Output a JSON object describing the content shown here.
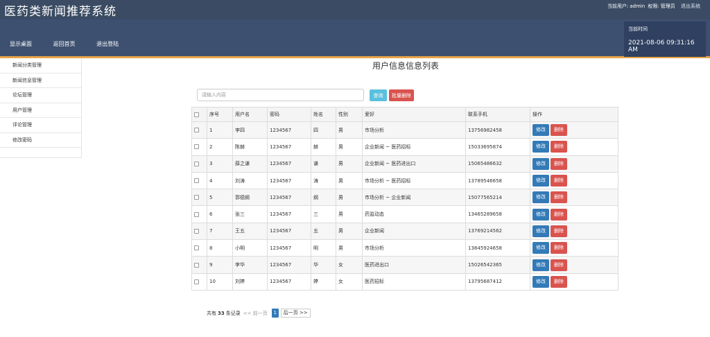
{
  "app": {
    "title": "医药类新闻推荐系统"
  },
  "header": {
    "user_label": "当前用户:",
    "user_name": "admin",
    "role_label": "权限:",
    "role_name": "管理员",
    "logout_label": "退出系统"
  },
  "nav": {
    "items": [
      "显示桌面",
      "返回首页",
      "退出登陆"
    ]
  },
  "clock": {
    "label": "当前时间",
    "value": "2021-08-06 09:31:16 AM"
  },
  "sidebar": {
    "items": [
      "新闻分类管理",
      "新闻信息管理",
      "论坛管理",
      "用户管理",
      "评论管理",
      "修改密码"
    ]
  },
  "main": {
    "title": "用户信息信息列表",
    "search_placeholder": "请输入内容",
    "search_button": "查询",
    "batch_delete_button": "批量删除"
  },
  "table": {
    "columns": [
      "序号",
      "用户名",
      "密码",
      "姓名",
      "性别",
      "爱好",
      "联系手机",
      "操作"
    ],
    "edit_label": "修改",
    "delete_label": "删除",
    "rows": [
      [
        "1",
        "李四",
        "1234567",
        "四",
        "男",
        "市场分析",
        "13756982458"
      ],
      [
        "2",
        "陈赫",
        "1234567",
        "赫",
        "男",
        "企业新闻 ~ 医药招标",
        "15033695874"
      ],
      [
        "3",
        "薛之谦",
        "1234567",
        "谦",
        "男",
        "企业新闻 ~ 医药进出口",
        "15065486632"
      ],
      [
        "4",
        "刘涛",
        "1234567",
        "涛",
        "男",
        "市场分析 ~ 医药招标",
        "13789546658"
      ],
      [
        "5",
        "郭德纲",
        "1234567",
        "纲",
        "男",
        "市场分析 ~ 企业新闻",
        "15077565214"
      ],
      [
        "6",
        "张三",
        "1234567",
        "三",
        "男",
        "药监动态",
        "13465289658"
      ],
      [
        "7",
        "王五",
        "1234567",
        "五",
        "男",
        "企业新闻",
        "13769214562"
      ],
      [
        "8",
        "小明",
        "1234567",
        "明",
        "男",
        "市场分析",
        "13845924658"
      ],
      [
        "9",
        "李华",
        "1234567",
        "华",
        "女",
        "医药进出口",
        "15026542365"
      ],
      [
        "10",
        "刘婷",
        "1234567",
        "婷",
        "女",
        "医药招标",
        "13795687412"
      ]
    ]
  },
  "pager": {
    "total_prefix": "共有",
    "total": "33",
    "total_suffix": "条记录",
    "prev_label": "<< 前一页",
    "current_page": "1",
    "next_label": "后一页 >>"
  }
}
